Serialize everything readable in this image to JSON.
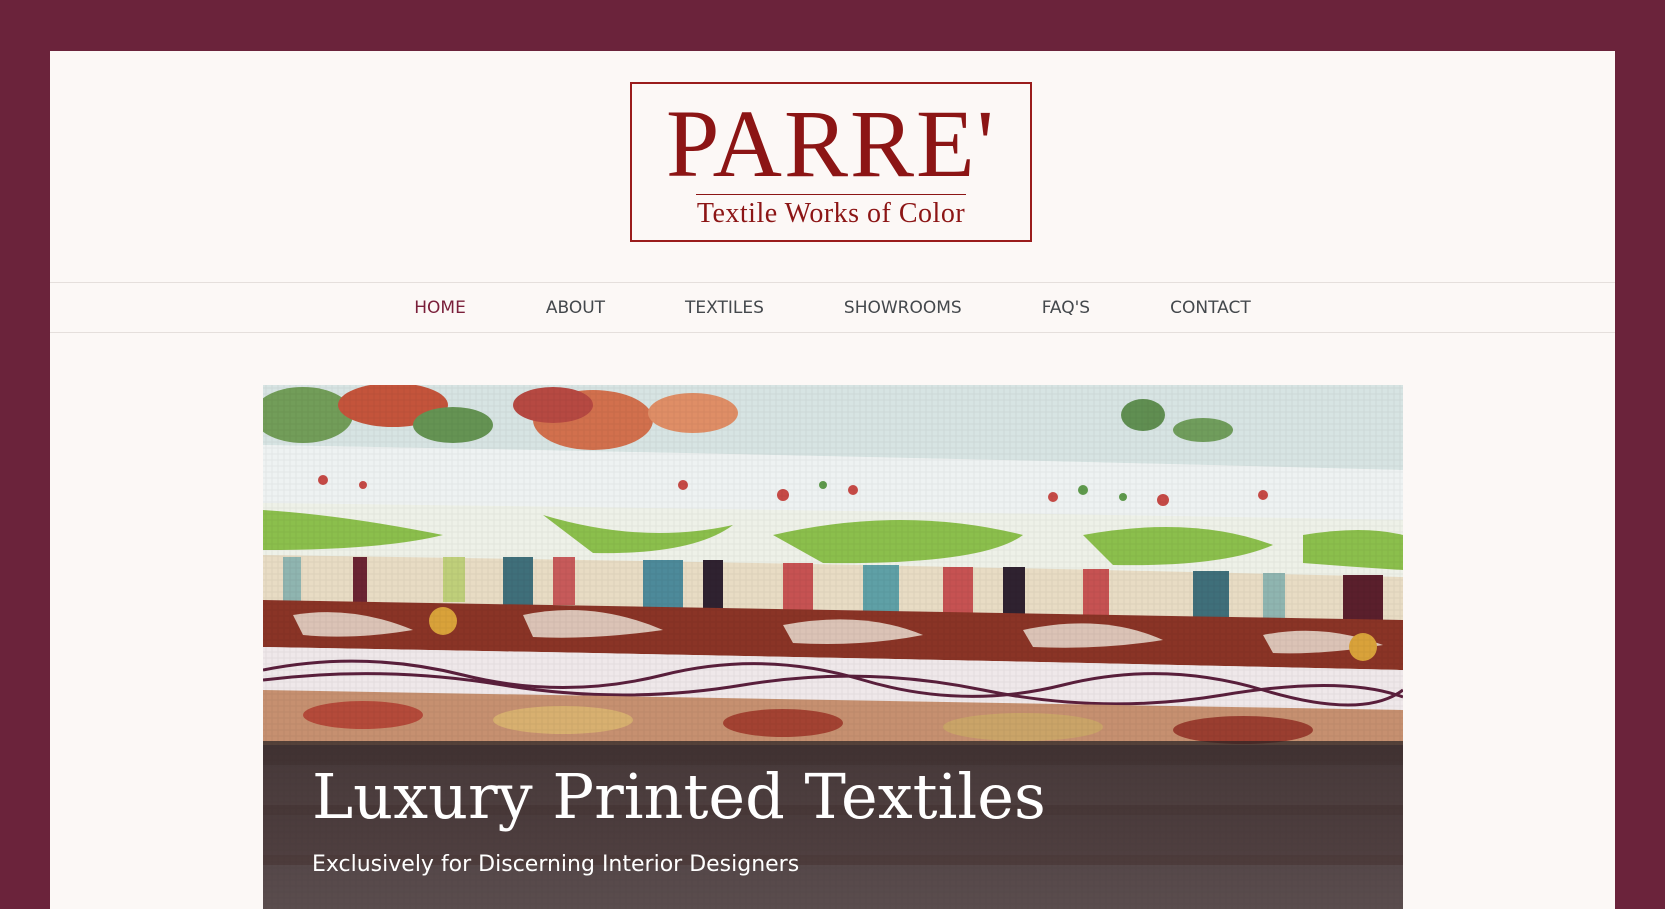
{
  "brand": {
    "name": "PARRE'",
    "tagline": "Textile Works of Color"
  },
  "nav": {
    "items": [
      {
        "label": "HOME"
      },
      {
        "label": "ABOUT"
      },
      {
        "label": "TEXTILES"
      },
      {
        "label": "SHOWROOMS"
      },
      {
        "label": "FAQ'S"
      },
      {
        "label": "CONTACT"
      }
    ],
    "active_index": 0
  },
  "hero": {
    "title": "Luxury Printed Textiles",
    "subtitle": "Exclusively for Discerning Interior Designers",
    "image": "stacked-printed-fabrics-photo"
  },
  "colors": {
    "frame": "#6b233b",
    "page": "#fcf8f6",
    "brand": "#8c1515",
    "nav_active": "#7a1f3a",
    "nav_text": "#44484c"
  }
}
